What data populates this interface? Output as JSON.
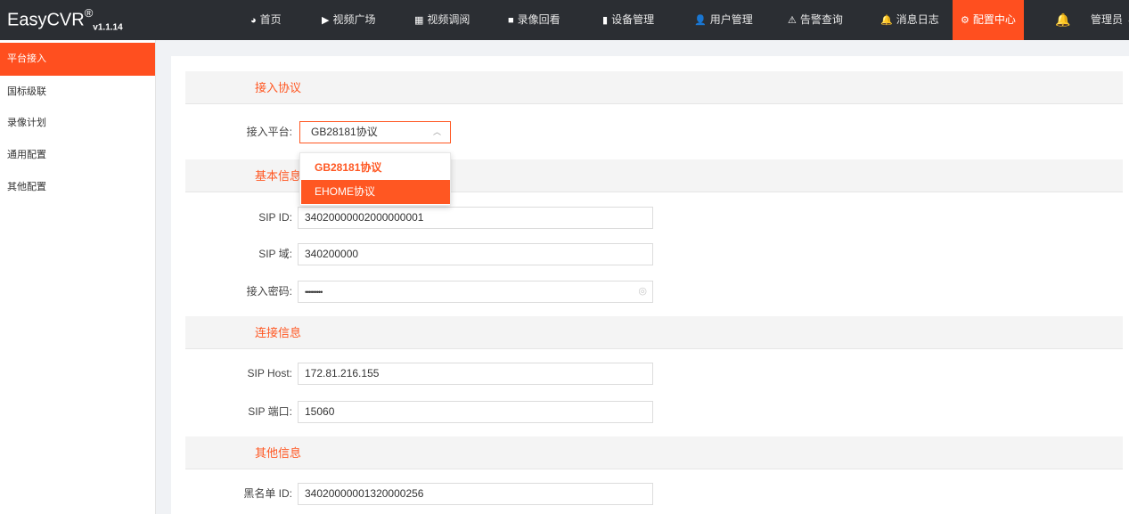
{
  "app": {
    "logo_main": "EasyCVR",
    "logo_reg": "®",
    "logo_version": "v1.1.14"
  },
  "nav": {
    "items": [
      {
        "label": "首页",
        "icon": "dashboard-icon"
      },
      {
        "label": "视频广场",
        "icon": "play-circle-icon"
      },
      {
        "label": "视频调阅",
        "icon": "grid-icon"
      },
      {
        "label": "录像回看",
        "icon": "video-camera-icon"
      },
      {
        "label": "设备管理",
        "icon": "device-icon"
      },
      {
        "label": "用户管理",
        "icon": "user-icon"
      },
      {
        "label": "告警查询",
        "icon": "alarm-icon"
      },
      {
        "label": "消息日志",
        "icon": "bell-icon"
      },
      {
        "label": "配置中心",
        "icon": "gear-icon"
      }
    ],
    "active": "配置中心",
    "user_label": "管理员"
  },
  "sidebar": {
    "items": [
      {
        "label": "平台接入"
      },
      {
        "label": "国标级联"
      },
      {
        "label": "录像计划"
      },
      {
        "label": "通用配置"
      },
      {
        "label": "其他配置"
      }
    ],
    "active": "平台接入"
  },
  "sections": {
    "protocol": "接入协议",
    "basic": "基本信息",
    "connection": "连接信息",
    "other": "其他信息"
  },
  "form": {
    "platform_label": "接入平台:",
    "platform_value": "GB28181协议",
    "platform_options": [
      "GB28181协议",
      "EHOME协议"
    ],
    "sip_id_label": "SIP ID:",
    "sip_id_value": "34020000002000000001",
    "sip_domain_label": "SIP 域:",
    "sip_domain_value": "340200000",
    "password_label": "接入密码:",
    "password_value": "•••••••••",
    "sip_host_label": "SIP Host:",
    "sip_host_value": "172.81.216.155",
    "sip_port_label": "SIP 端口:",
    "sip_port_value": "15060",
    "blacklist_label": "黑名单 ID:",
    "blacklist_value": "34020000001320000256"
  },
  "colors": {
    "accent": "#ff5722",
    "topbar": "#2b2e33"
  }
}
